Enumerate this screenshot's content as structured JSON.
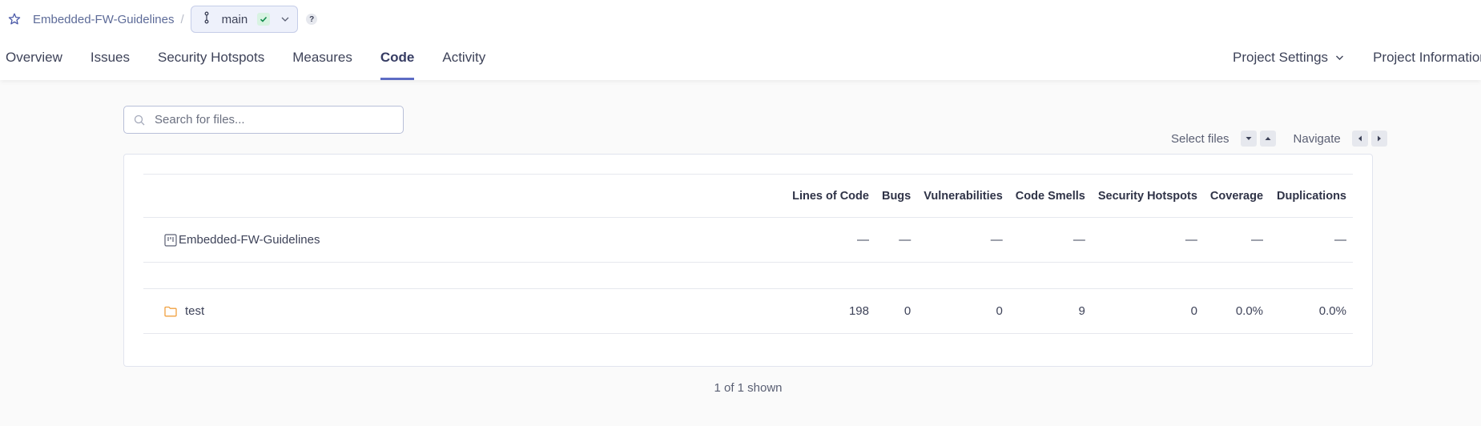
{
  "breadcrumb": {
    "project": "Embedded-FW-Guidelines",
    "separator": "/",
    "branch": "main",
    "help": "?"
  },
  "nav": {
    "tabs": [
      "Overview",
      "Issues",
      "Security Hotspots",
      "Measures",
      "Code",
      "Activity"
    ],
    "active": "Code",
    "project_settings": "Project Settings",
    "project_information": "Project Information"
  },
  "search": {
    "placeholder": "Search for files..."
  },
  "toolbar": {
    "select_files": "Select files",
    "navigate": "Navigate"
  },
  "table": {
    "columns": [
      "Lines of Code",
      "Bugs",
      "Vulnerabilities",
      "Code Smells",
      "Security Hotspots",
      "Coverage",
      "Duplications"
    ],
    "project_row": {
      "name": "Embedded-FW-Guidelines",
      "values": [
        "—",
        "—",
        "—",
        "—",
        "—",
        "—",
        "—"
      ]
    },
    "rows": [
      {
        "name": "test",
        "values": [
          "198",
          "0",
          "0",
          "9",
          "0",
          "0.0%",
          "0.0%"
        ]
      }
    ]
  },
  "footer": {
    "shown": "1 of 1 shown"
  },
  "colors": {
    "accent": "#5d6cc4",
    "folder": "#f0a040",
    "check": "#0e8a4a"
  }
}
